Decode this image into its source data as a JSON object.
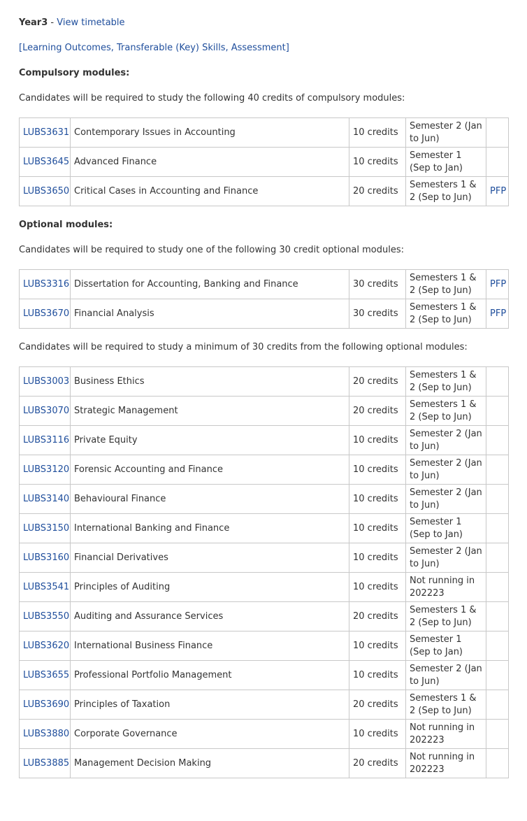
{
  "year": {
    "label": "Year3",
    "separator": " - ",
    "timetable_link": "View timetable"
  },
  "outcomes_link": "[Learning Outcomes, Transferable (Key) Skills, Assessment]",
  "compulsory": {
    "heading": "Compulsory modules:",
    "intro": "Candidates will be required to study the following 40 credits of compulsory modules:",
    "rows": [
      {
        "code": "LUBS3631",
        "title": "Contemporary Issues in Accounting",
        "credits": "10 credits",
        "semester": "Semester 2 (Jan to Jun)",
        "pfp": ""
      },
      {
        "code": "LUBS3645",
        "title": "Advanced Finance",
        "credits": "10 credits",
        "semester": "Semester 1 (Sep to Jan)",
        "pfp": ""
      },
      {
        "code": "LUBS3650",
        "title": "Critical Cases in Accounting and Finance",
        "credits": "20 credits",
        "semester": "Semesters 1 & 2 (Sep to Jun)",
        "pfp": "PFP"
      }
    ]
  },
  "optional": {
    "heading": "Optional modules:",
    "intro1": "Candidates will be required to study one of the following 30 credit optional modules:",
    "rows1": [
      {
        "code": "LUBS3316",
        "title": "Dissertation for Accounting, Banking and Finance",
        "credits": "30 credits",
        "semester": "Semesters 1 & 2 (Sep to Jun)",
        "pfp": "PFP"
      },
      {
        "code": "LUBS3670",
        "title": "Financial Analysis",
        "credits": "30 credits",
        "semester": "Semesters 1 & 2 (Sep to Jun)",
        "pfp": "PFP"
      }
    ],
    "intro2": "Candidates will be required to study a minimum of 30 credits from the following optional modules:",
    "rows2": [
      {
        "code": "LUBS3003",
        "title": "Business Ethics",
        "credits": "20 credits",
        "semester": "Semesters 1 & 2 (Sep to Jun)",
        "pfp": ""
      },
      {
        "code": "LUBS3070",
        "title": "Strategic Management",
        "credits": "20 credits",
        "semester": "Semesters 1 & 2 (Sep to Jun)",
        "pfp": ""
      },
      {
        "code": "LUBS3116",
        "title": "Private Equity",
        "credits": "10 credits",
        "semester": "Semester 2 (Jan to Jun)",
        "pfp": ""
      },
      {
        "code": "LUBS3120",
        "title": "Forensic Accounting and Finance",
        "credits": "10 credits",
        "semester": "Semester 2 (Jan to Jun)",
        "pfp": ""
      },
      {
        "code": "LUBS3140",
        "title": "Behavioural Finance",
        "credits": "10 credits",
        "semester": "Semester 2 (Jan to Jun)",
        "pfp": ""
      },
      {
        "code": "LUBS3150",
        "title": "International Banking and Finance",
        "credits": "10 credits",
        "semester": "Semester 1 (Sep to Jan)",
        "pfp": ""
      },
      {
        "code": "LUBS3160",
        "title": "Financial Derivatives",
        "credits": "10 credits",
        "semester": "Semester 2 (Jan to Jun)",
        "pfp": ""
      },
      {
        "code": "LUBS3541",
        "title": "Principles of Auditing",
        "credits": "10 credits",
        "semester": "Not running in 202223",
        "pfp": ""
      },
      {
        "code": "LUBS3550",
        "title": "Auditing and Assurance Services",
        "credits": "20 credits",
        "semester": "Semesters 1 & 2 (Sep to Jun)",
        "pfp": ""
      },
      {
        "code": "LUBS3620",
        "title": "International Business Finance",
        "credits": "10 credits",
        "semester": "Semester 1 (Sep to Jan)",
        "pfp": ""
      },
      {
        "code": "LUBS3655",
        "title": "Professional Portfolio Management",
        "credits": "10 credits",
        "semester": "Semester 2 (Jan to Jun)",
        "pfp": ""
      },
      {
        "code": "LUBS3690",
        "title": "Principles of Taxation",
        "credits": "20 credits",
        "semester": "Semesters 1 & 2 (Sep to Jun)",
        "pfp": ""
      },
      {
        "code": "LUBS3880",
        "title": "Corporate Governance",
        "credits": "10 credits",
        "semester": "Not running in 202223",
        "pfp": ""
      },
      {
        "code": "LUBS3885",
        "title": "Management Decision Making",
        "credits": "20 credits",
        "semester": "Not running in 202223",
        "pfp": ""
      }
    ]
  }
}
